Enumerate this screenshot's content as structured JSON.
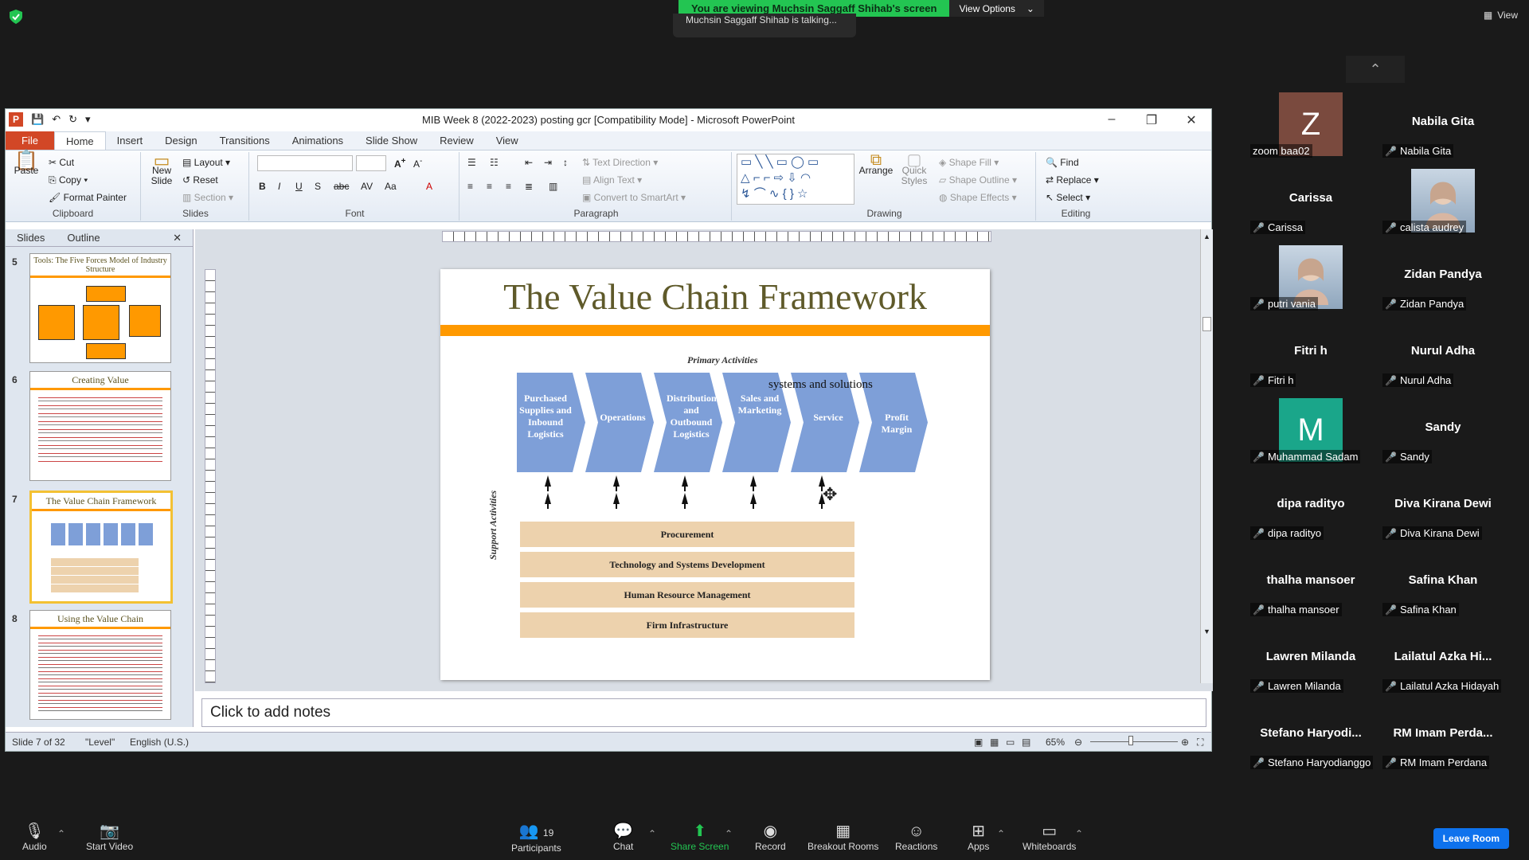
{
  "zoom": {
    "share_banner": "You are viewing Muchsin Saggaff Shihab's screen",
    "view_options": "View Options",
    "talking": "Muchsin Saggaff Shihab is talking...",
    "view_label": "View",
    "leave": "Leave Room",
    "toolbar": {
      "audio": "Audio",
      "video": "Start Video",
      "participants": "Participants",
      "participants_count": "19",
      "chat": "Chat",
      "share": "Share Screen",
      "record": "Record",
      "breakout": "Breakout Rooms",
      "reactions": "Reactions",
      "apps": "Apps",
      "whiteboards": "Whiteboards"
    },
    "participants": [
      {
        "name": "Z",
        "label": "zoom baa02",
        "avatar_color": "#7a4a3e"
      },
      {
        "name": "Nabila Gita",
        "label": "Nabila Gita"
      },
      {
        "name": "Carissa",
        "label": "Carissa"
      },
      {
        "name": "",
        "label": "calista audrey",
        "photo": true
      },
      {
        "name": "",
        "label": "putri vania",
        "photo": true
      },
      {
        "name": "Zidan Pandya",
        "label": "Zidan Pandya"
      },
      {
        "name": "Fitri h",
        "label": "Fitri h"
      },
      {
        "name": "Nurul Adha",
        "label": "Nurul Adha"
      },
      {
        "name": "M",
        "label": "Muhammad Sadam",
        "avatar_color": "#1aa68a"
      },
      {
        "name": "Sandy",
        "label": "Sandy"
      },
      {
        "name": "dipa radityo",
        "label": "dipa radityo"
      },
      {
        "name": "Diva Kirana Dewi",
        "label": "Diva Kirana Dewi"
      },
      {
        "name": "thalha mansoer",
        "label": "thalha mansoer"
      },
      {
        "name": "Safina Khan",
        "label": "Safina Khan"
      },
      {
        "name": "Lawren Milanda",
        "label": "Lawren Milanda"
      },
      {
        "name": "Lailatul  Azka  Hi...",
        "label": "Lailatul Azka Hidayah"
      },
      {
        "name": "Stefano  Haryodi...",
        "label": "Stefano Haryodianggo"
      },
      {
        "name": "RM Imam Perda...",
        "label": "RM Imam Perdana"
      }
    ]
  },
  "ppt": {
    "title": "MIB Week 8 (2022-2023) posting gcr [Compatibility Mode]  -  Microsoft PowerPoint",
    "tabs": [
      "File",
      "Home",
      "Insert",
      "Design",
      "Transitions",
      "Animations",
      "Slide Show",
      "Review",
      "View"
    ],
    "ribbon": {
      "clipboard": {
        "label": "Clipboard",
        "paste": "Paste",
        "cut": "Cut",
        "copy": "Copy",
        "format_painter": "Format Painter"
      },
      "slides": {
        "label": "Slides",
        "new_slide": "New Slide",
        "layout": "Layout",
        "reset": "Reset",
        "section": "Section"
      },
      "font": {
        "label": "Font"
      },
      "paragraph": {
        "label": "Paragraph",
        "text_direction": "Text Direction",
        "align_text": "Align Text",
        "smartart": "Convert to SmartArt"
      },
      "drawing": {
        "label": "Drawing",
        "arrange": "Arrange",
        "quick_styles": "Quick Styles",
        "shape_fill": "Shape Fill",
        "shape_outline": "Shape Outline",
        "shape_effects": "Shape Effects"
      },
      "editing": {
        "label": "Editing",
        "find": "Find",
        "replace": "Replace",
        "select": "Select"
      }
    },
    "pane_tabs": {
      "slides": "Slides",
      "outline": "Outline"
    },
    "thumbnails": [
      {
        "num": "5",
        "title": "Tools: The Five Forces Model of Industry Structure"
      },
      {
        "num": "6",
        "title": "Creating Value"
      },
      {
        "num": "7",
        "title": "The Value Chain Framework"
      },
      {
        "num": "8",
        "title": "Using the Value Chain"
      }
    ],
    "slide": {
      "title": "The Value Chain Framework",
      "primary_label": "Primary Activities",
      "overlay_text": "systems  and solutions",
      "primary": [
        "Purchased Supplies and Inbound Logistics",
        "Operations",
        "Distribution and Outbound Logistics",
        "Sales and Marketing",
        "Service",
        "Profit Margin"
      ],
      "support_label": "Support Activities",
      "support": [
        "Procurement",
        "Technology and Systems Development",
        "Human Resource Management",
        "Firm Infrastructure"
      ]
    },
    "notes": "Click to add notes",
    "status": {
      "slide": "Slide 7 of 32",
      "theme": "\"Level\"",
      "lang": "English (U.S.)",
      "zoom": "65%"
    },
    "colors": {
      "chevron": "#7e9fd8",
      "orange": "#ff9900",
      "support": "#edd2ad",
      "file_tab": "#d24726"
    }
  }
}
